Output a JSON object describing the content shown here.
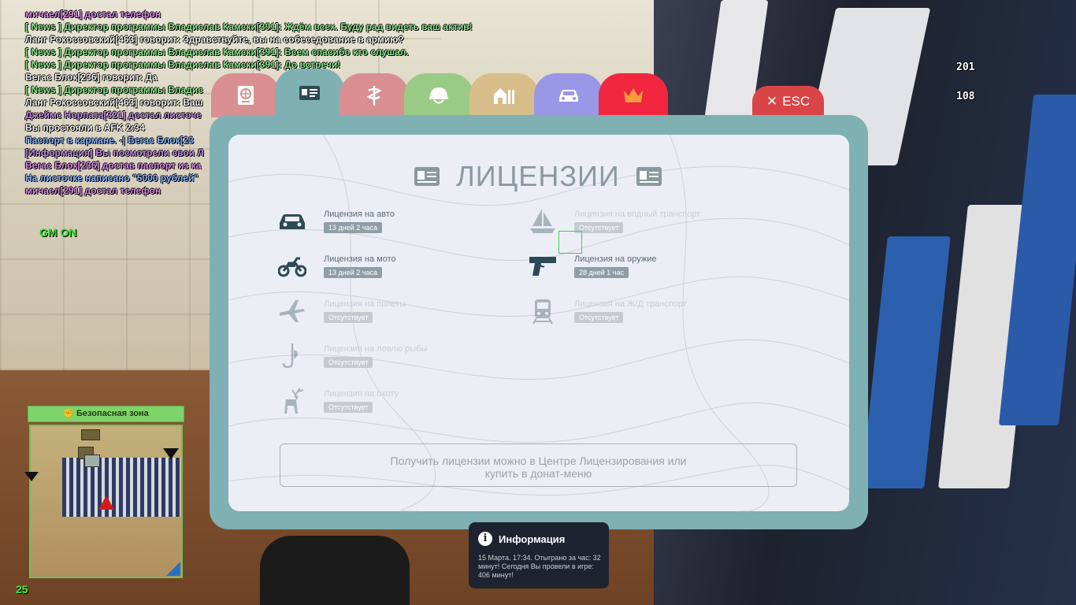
{
  "chat": [
    {
      "text": "мичаел[291] достал телефон",
      "color": "#d98be6"
    },
    {
      "text": "[ News ] Директор программы Владислав Камски[391]: Ждём всех. Буду рад видеть ваш актив!",
      "color": "#8be68b"
    },
    {
      "text": "Ланг Рокоссовский[463] говорит: Здравствуйте, вы на собеседование в армию?",
      "color": "#f2f2f2"
    },
    {
      "text": "[ News ] Директор программы Владислав Камски[391]: Всем спасибо кто слушал.",
      "color": "#8be68b"
    },
    {
      "text": "[ News ] Директор программы Владислав Камски[391]: До встречи!",
      "color": "#8be68b"
    },
    {
      "text": "Вегас Блок[236] говорит: Да",
      "color": "#f2f2f2"
    },
    {
      "text": "[ News ] Директор программы Владис",
      "color": "#8be68b"
    },
    {
      "text": "Ланг Рокоссовский[463] говорит: Ваш",
      "color": "#f2f2f2"
    },
    {
      "text": "Джеймс Норпата[321] достал листоче",
      "color": "#c48be6"
    },
    {
      "text": "Вы простояли в AFK 2:34",
      "color": "#f2f2f2"
    },
    {
      "text": " Паспорт в кармане.  -|  Вегас Блок[23",
      "color": "#8bb6ff"
    },
    {
      "text": "[Информация] Вы посмотрели свои Л",
      "color": "#c48be6"
    },
    {
      "text": "Вегас Блок[236] достав паспорт из ка",
      "color": "#d98be6"
    },
    {
      "text": " На листочке написано \"5000 рублей\"",
      "color": "#8bb6ff"
    },
    {
      "text": "мичаел[291] достал телефон",
      "color": "#d98be6"
    }
  ],
  "gm_status": "GM ON",
  "hud": {
    "value_1": "201",
    "value_2": "108",
    "fps": "25"
  },
  "minimap": {
    "zone_label": "Безопасная зона"
  },
  "tabs": [
    {
      "name": "passport-tab",
      "icon": "passport-icon",
      "color": "#d98f92"
    },
    {
      "name": "licenses-tab",
      "icon": "id-card-icon",
      "color": "#7fb0b4",
      "active": true
    },
    {
      "name": "medical-tab",
      "icon": "medical-icon",
      "color": "#d98f92"
    },
    {
      "name": "military-tab",
      "icon": "helmet-icon",
      "color": "#9acb86"
    },
    {
      "name": "property-tab",
      "icon": "houses-icon",
      "color": "#d7bd89"
    },
    {
      "name": "vehicles-tab",
      "icon": "car-icon",
      "color": "#9a97e6"
    },
    {
      "name": "donate-tab",
      "icon": "crown-icon",
      "color": "#f2263f"
    }
  ],
  "esc_label": "ESC",
  "title": "ЛИЦЕНЗИИ",
  "licenses": {
    "car": {
      "label": "Лицензия на авто",
      "status": "13 дней 2 часа",
      "active": true
    },
    "moto": {
      "label": "Лицензия на мото",
      "status": "13 дней 2 часа",
      "active": true
    },
    "plane": {
      "label": "Лицензия на полеты",
      "status": "Отсутствует",
      "active": false
    },
    "fishing": {
      "label": "Лицензия на ловлю рыбы",
      "status": "Отсутствует",
      "active": false
    },
    "hunting": {
      "label": "Лицензия на охоту",
      "status": "Отсутствует",
      "active": false
    },
    "boat": {
      "label": "Лицензия на водный транспорт",
      "status": "Отсутствует",
      "active": false
    },
    "weapon": {
      "label": "Лицензия на оружие",
      "status": "28 дней 1 час",
      "active": true
    },
    "train": {
      "label": "Лицензия на Ж/Д транспорт",
      "status": "Отсутствует",
      "active": false
    }
  },
  "info_text_line1": "Получить лицензии можно в Центре Лицензирования или",
  "info_text_line2": "купить в донат-меню",
  "notification": {
    "title": "Информация",
    "body": "15 Марта. 17:34. Отыграно за час: 32 минут! Сегодня Вы провели в игре: 406 минут!"
  }
}
